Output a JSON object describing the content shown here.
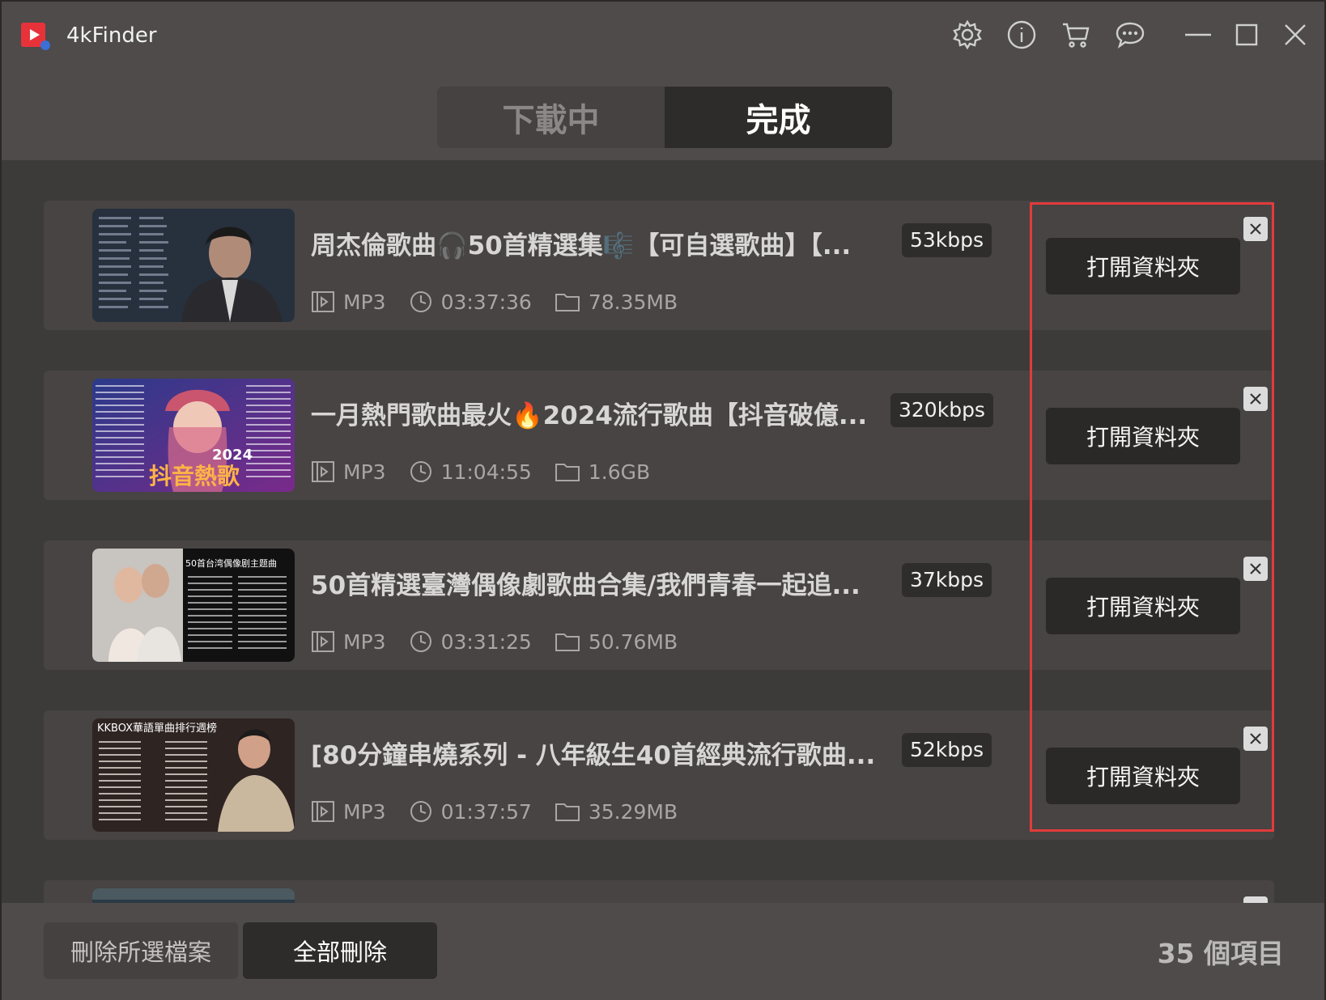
{
  "app": {
    "title": "4kFinder"
  },
  "titlebar_icons": [
    "gear-icon",
    "info-icon",
    "cart-icon",
    "chat-icon",
    "minimize-icon",
    "maximize-icon",
    "close-icon"
  ],
  "tabs": [
    {
      "label": "下載中",
      "active": false
    },
    {
      "label": "完成",
      "active": true
    }
  ],
  "items": [
    {
      "title": "周杰倫歌曲🎧50首精選集🎼【可自選歌曲】【...",
      "bitrate": "53kbps",
      "format": "MP3",
      "duration": "03:37:36",
      "size": "78.35MB",
      "button": "打開資料夾"
    },
    {
      "title": "一月熱門歌曲最火🔥2024流行歌曲【抖音破億...",
      "bitrate": "320kbps",
      "format": "MP3",
      "duration": "11:04:55",
      "size": "1.6GB",
      "button": "打開資料夾",
      "thumb_text": [
        "2024",
        "抖音熱歌"
      ]
    },
    {
      "title": "50首精選臺灣偶像劇歌曲合集/我們青春一起追...",
      "bitrate": "37kbps",
      "format": "MP3",
      "duration": "03:31:25",
      "size": "50.76MB",
      "button": "打開資料夾",
      "thumb_text": [
        "50首台湾偶像剧主题曲"
      ]
    },
    {
      "title": "[80分鐘串燒系列 - 八年級生40首經典流行歌曲...",
      "bitrate": "52kbps",
      "format": "MP3",
      "duration": "01:37:57",
      "size": "35.29MB",
      "button": "打開資料夾",
      "thumb_text": [
        "KKBOX華語單曲排行週榜"
      ]
    }
  ],
  "bottom": {
    "delete_selected": "刪除所選檔案",
    "delete_all": "全部刪除",
    "count": "35 個項目"
  },
  "colors": {
    "highlight": "#e23b3b",
    "background": "#4e4b4a",
    "button": "#2b2928"
  }
}
